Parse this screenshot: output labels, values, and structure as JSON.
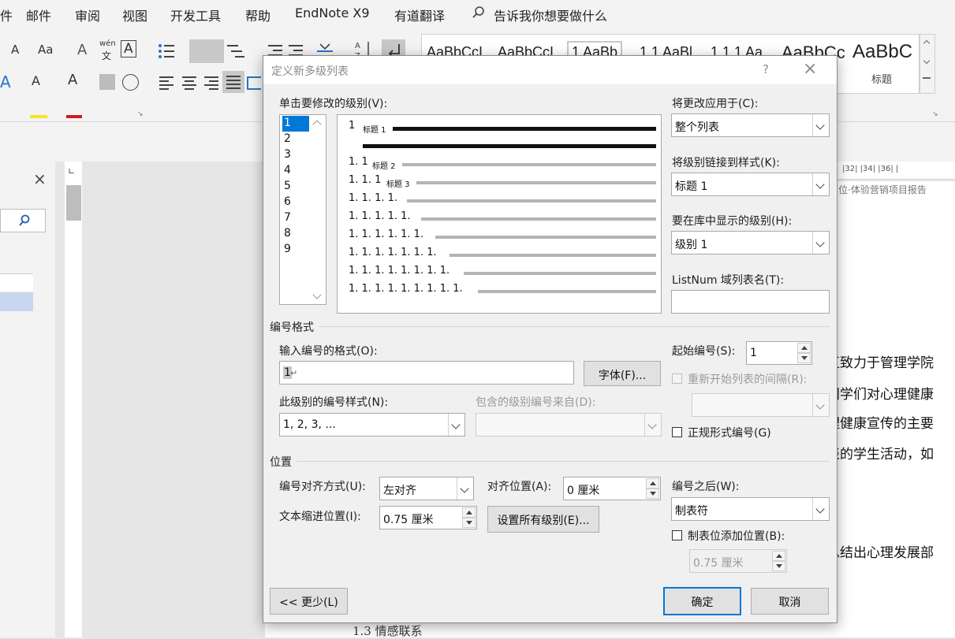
{
  "menubar": {
    "items": [
      "件",
      "邮件",
      "审阅",
      "视图",
      "开发工具",
      "帮助",
      "EndNote X9",
      "有道翻译"
    ],
    "tell_me": "告诉我你想要做什么"
  },
  "ribbon": {
    "font_size_a": "A",
    "change_case": "Aa",
    "wen": "wén",
    "wen2": "文",
    "boxed_a": "A",
    "font_color_a": "A",
    "highlight": "A",
    "big_a": "A",
    "styles": [
      "AaBbCcI",
      "AaBbCcI",
      "1 AaBb",
      "1.1 AaBl",
      "1.1.1 Aa",
      "AaBbCc",
      "AaBbC"
    ],
    "style_caption": "标题"
  },
  "document": {
    "ruler_numbers": "|32| |34| |36| |",
    "header_text": "位·体验营销项目报告",
    "lines": [
      "直致力于管理学院",
      "同学们对心理健康",
      "理健康宣传的主要",
      "表的学生活动，如",
      "总结出心理发展部"
    ],
    "bottom_text": "1.3   情感联系"
  },
  "dialog": {
    "title": "定义新多级列表",
    "help": "?",
    "close": "×",
    "level_label": "单击要修改的级别(V):",
    "levels": [
      "1",
      "2",
      "3",
      "4",
      "5",
      "6",
      "7",
      "8",
      "9"
    ],
    "selected_level": "1",
    "preview": {
      "rows": [
        {
          "num": "1",
          "tag": "标题 1"
        },
        {
          "num": "1. 1",
          "tag": "标题 2"
        },
        {
          "num": "1. 1. 1",
          "tag": "标题 3"
        },
        {
          "num": "1. 1. 1. 1.",
          "tag": ""
        },
        {
          "num": "1. 1. 1. 1. 1.",
          "tag": ""
        },
        {
          "num": "1. 1. 1. 1. 1. 1.",
          "tag": ""
        },
        {
          "num": "1. 1. 1. 1. 1. 1. 1.",
          "tag": ""
        },
        {
          "num": "1. 1. 1. 1. 1. 1. 1. 1.",
          "tag": ""
        },
        {
          "num": "1. 1. 1. 1. 1. 1. 1. 1. 1.",
          "tag": ""
        }
      ]
    },
    "apply_to_label": "将更改应用于(C):",
    "apply_to_value": "整个列表",
    "link_style_label": "将级别链接到样式(K):",
    "link_style_value": "标题 1",
    "gallery_level_label": "要在库中显示的级别(H):",
    "gallery_level_value": "级别 1",
    "listnum_label": "ListNum 域列表名(T):",
    "listnum_value": "",
    "number_format_section": "编号格式",
    "enter_format_label": "输入编号的格式(O):",
    "enter_format_value": "1",
    "enter_format_mark": "↵",
    "font_button": "字体(F)...",
    "start_at_label": "起始编号(S):",
    "start_at_value": "1",
    "restart_label": "重新开始列表的间隔(R):",
    "restart_value": "",
    "number_style_label": "此级别的编号样式(N):",
    "number_style_value": "1, 2, 3, ...",
    "include_from_label": "包含的级别编号来自(D):",
    "include_from_value": "",
    "legal_label": "正规形式编号(G)",
    "position_section": "位置",
    "alignment_label": "编号对齐方式(U):",
    "alignment_value": "左对齐",
    "aligned_at_label": "对齐位置(A):",
    "aligned_at_value": "0 厘米",
    "indent_label": "文本缩进位置(I):",
    "indent_value": "0.75 厘米",
    "set_all_button": "设置所有级别(E)...",
    "follow_label": "编号之后(W):",
    "follow_value": "制表符",
    "tab_stop_label": "制表位添加位置(B):",
    "tab_stop_value": "0.75 厘米",
    "less_button": "<< 更少(L)",
    "ok_button": "确定",
    "cancel_button": "取消"
  }
}
